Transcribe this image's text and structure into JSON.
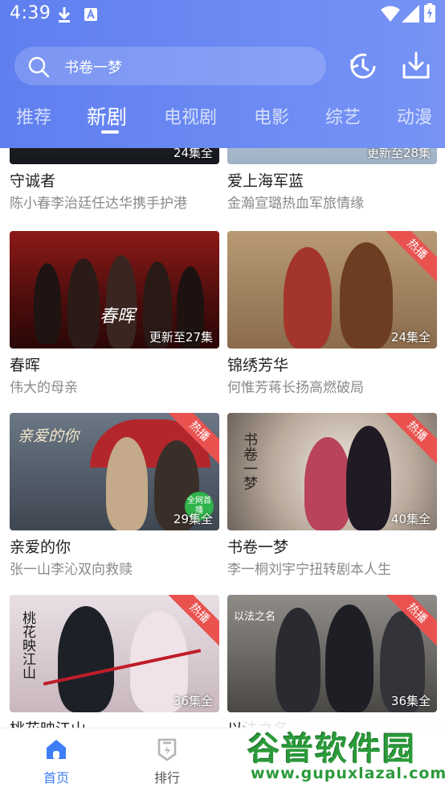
{
  "status_bar": {
    "time": "4:39"
  },
  "search": {
    "text": "书卷一梦"
  },
  "tabs": [
    {
      "label": "推荐"
    },
    {
      "label": "新剧",
      "active": true
    },
    {
      "label": "电视剧"
    },
    {
      "label": "电影"
    },
    {
      "label": "综艺"
    },
    {
      "label": "动漫"
    }
  ],
  "cards": [
    {
      "title": "守诚者",
      "subtitle": "陈小春李治廷任达华携手护港",
      "badge": "24集全",
      "hot": false
    },
    {
      "title": "爱上海军蓝",
      "subtitle": "金瀚宣璐热血军旅情缘",
      "badge": "更新至28集",
      "hot": false
    },
    {
      "title": "春晖",
      "subtitle": "伟大的母亲",
      "badge": "更新至27集",
      "hot": false,
      "poster_text": "春晖"
    },
    {
      "title": "锦绣芳华",
      "subtitle": "何惟芳蒋长扬高燃破局",
      "badge": "24集全",
      "hot": true,
      "hot_label": "热播"
    },
    {
      "title": "亲爱的你",
      "subtitle": "张一山李沁双向救赎",
      "badge": "29集全",
      "hot": true,
      "hot_label": "热播",
      "poster_text": "亲爱的你",
      "sticker": "全网首播"
    },
    {
      "title": "书卷一梦",
      "subtitle": "李一桐刘宇宁扭转剧本人生",
      "badge": "40集全",
      "hot": true,
      "hot_label": "热播",
      "poster_text": "书卷一梦"
    },
    {
      "title": "桃花映江山",
      "subtitle": "",
      "badge": "36集全",
      "hot": true,
      "hot_label": "热播",
      "poster_text": "桃花映江山"
    },
    {
      "title": "以法之名",
      "subtitle": "",
      "badge": "36集全",
      "hot": true,
      "hot_label": "热播",
      "poster_text": "以法之名"
    }
  ],
  "bottom_nav": [
    {
      "label": "首页",
      "active": true
    },
    {
      "label": "排行"
    }
  ],
  "watermark": {
    "title": "谷普软件园",
    "url": "www.gupuxlazal.com"
  },
  "colors": {
    "accent": "#5f7ff0",
    "hot": "#e9524f",
    "nav_active": "#3d7ef6"
  }
}
